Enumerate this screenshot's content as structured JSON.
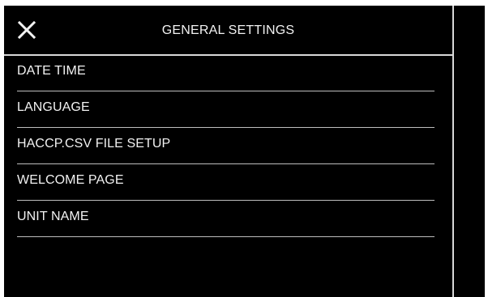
{
  "header": {
    "title": "GENERAL SETTINGS"
  },
  "icons": {
    "close": "close-icon"
  },
  "colors": {
    "background": "#000000",
    "text": "#f2f2f2",
    "divider": "#bdbdbd",
    "frame": "#ffffff"
  },
  "menu": {
    "items": [
      {
        "label": "DATE  TIME"
      },
      {
        "label": "LANGUAGE"
      },
      {
        "label": "HACCP.CSV FILE SETUP"
      },
      {
        "label": "WELCOME PAGE"
      },
      {
        "label": "UNIT NAME"
      }
    ]
  }
}
